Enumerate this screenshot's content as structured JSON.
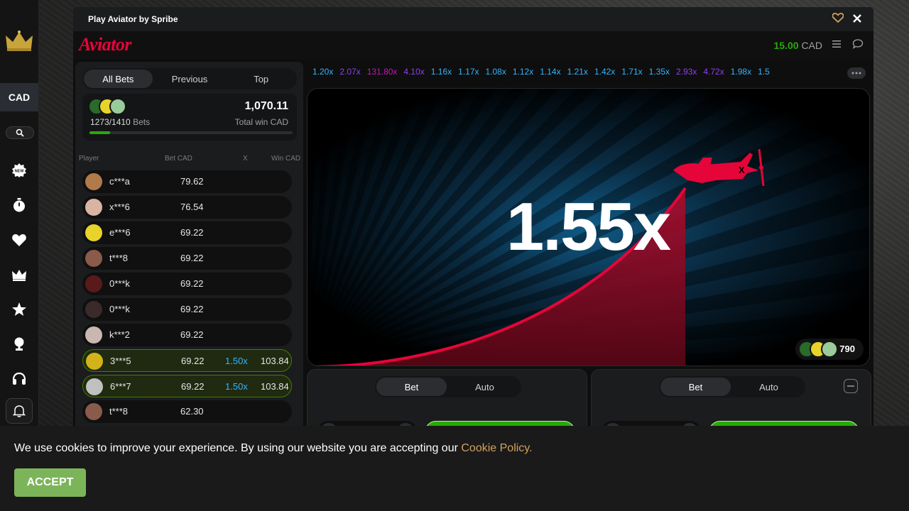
{
  "sidebar": {
    "currency": "CAD",
    "icons": [
      "crown-logo-icon",
      "search-icon",
      "new-badge-icon",
      "stopwatch-icon",
      "heart-icon",
      "crown-icon",
      "star-icon",
      "trophy-icon",
      "headset-icon",
      "bell-icon"
    ]
  },
  "window": {
    "title": "Play Aviator by Spribe"
  },
  "header": {
    "logo": "Aviator",
    "balance_amount": "15.00",
    "balance_currency": "CAD"
  },
  "bets": {
    "tabs": [
      "All Bets",
      "Previous",
      "Top"
    ],
    "active_tab": "All Bets",
    "bets_count": "1273/1410",
    "bets_label": "Bets",
    "total_win": "1,070.11",
    "total_win_label": "Total win CAD",
    "progress_fraction": 0.1,
    "columns": [
      "Player",
      "Bet CAD",
      "X",
      "Win CAD"
    ],
    "rows": [
      {
        "name": "c***a",
        "bet": "79.62",
        "mult": "",
        "win": "",
        "won": false,
        "avatar": "#b07a4a"
      },
      {
        "name": "x***6",
        "bet": "76.54",
        "mult": "",
        "win": "",
        "won": false,
        "avatar": "#d9b3a3"
      },
      {
        "name": "e***6",
        "bet": "69.22",
        "mult": "",
        "win": "",
        "won": false,
        "avatar": "#e8d32a"
      },
      {
        "name": "t***8",
        "bet": "69.22",
        "mult": "",
        "win": "",
        "won": false,
        "avatar": "#8a5a4a"
      },
      {
        "name": "0***k",
        "bet": "69.22",
        "mult": "",
        "win": "",
        "won": false,
        "avatar": "#5a1a1a"
      },
      {
        "name": "0***k",
        "bet": "69.22",
        "mult": "",
        "win": "",
        "won": false,
        "avatar": "#3a2a2a"
      },
      {
        "name": "k***2",
        "bet": "69.22",
        "mult": "",
        "win": "",
        "won": false,
        "avatar": "#c8b8b0"
      },
      {
        "name": "3***5",
        "bet": "69.22",
        "mult": "1.50x",
        "win": "103.84",
        "won": true,
        "avatar": "#d4b21a"
      },
      {
        "name": "6***7",
        "bet": "69.22",
        "mult": "1.50x",
        "win": "103.84",
        "won": true,
        "avatar": "#c0c0c0"
      },
      {
        "name": "t***8",
        "bet": "62.30",
        "mult": "",
        "win": "",
        "won": false,
        "avatar": "#8a5a4a"
      }
    ]
  },
  "history": [
    {
      "v": "1.20x",
      "c": "#34b4ff"
    },
    {
      "v": "2.07x",
      "c": "#913ef8"
    },
    {
      "v": "131.80x",
      "c": "#c017b4"
    },
    {
      "v": "4.10x",
      "c": "#913ef8"
    },
    {
      "v": "1.16x",
      "c": "#34b4ff"
    },
    {
      "v": "1.17x",
      "c": "#34b4ff"
    },
    {
      "v": "1.08x",
      "c": "#34b4ff"
    },
    {
      "v": "1.12x",
      "c": "#34b4ff"
    },
    {
      "v": "1.14x",
      "c": "#34b4ff"
    },
    {
      "v": "1.21x",
      "c": "#34b4ff"
    },
    {
      "v": "1.42x",
      "c": "#34b4ff"
    },
    {
      "v": "1.71x",
      "c": "#34b4ff"
    },
    {
      "v": "1.35x",
      "c": "#34b4ff"
    },
    {
      "v": "2.93x",
      "c": "#913ef8"
    },
    {
      "v": "4.72x",
      "c": "#913ef8"
    },
    {
      "v": "1.98x",
      "c": "#34b4ff"
    },
    {
      "v": "1.5",
      "c": "#34b4ff"
    }
  ],
  "game": {
    "multiplier": "1.55x",
    "online_count": "790"
  },
  "bet_panels": [
    {
      "tabs": [
        "Bet",
        "Auto"
      ],
      "active": "Bet"
    },
    {
      "tabs": [
        "Bet",
        "Auto"
      ],
      "active": "Bet"
    }
  ],
  "cookie": {
    "text": "We use cookies to improve your experience. By using our website you are accepting our ",
    "link": "Cookie Policy.",
    "accept": "ACCEPT"
  },
  "colors": {
    "accent_red": "#e50539",
    "win_green": "#28a909",
    "mult_blue": "#34b4ff",
    "mult_purple": "#913ef8",
    "mult_pink": "#c017b4",
    "cookie_link": "#d1a25e",
    "accept_green": "#7cb45a"
  }
}
